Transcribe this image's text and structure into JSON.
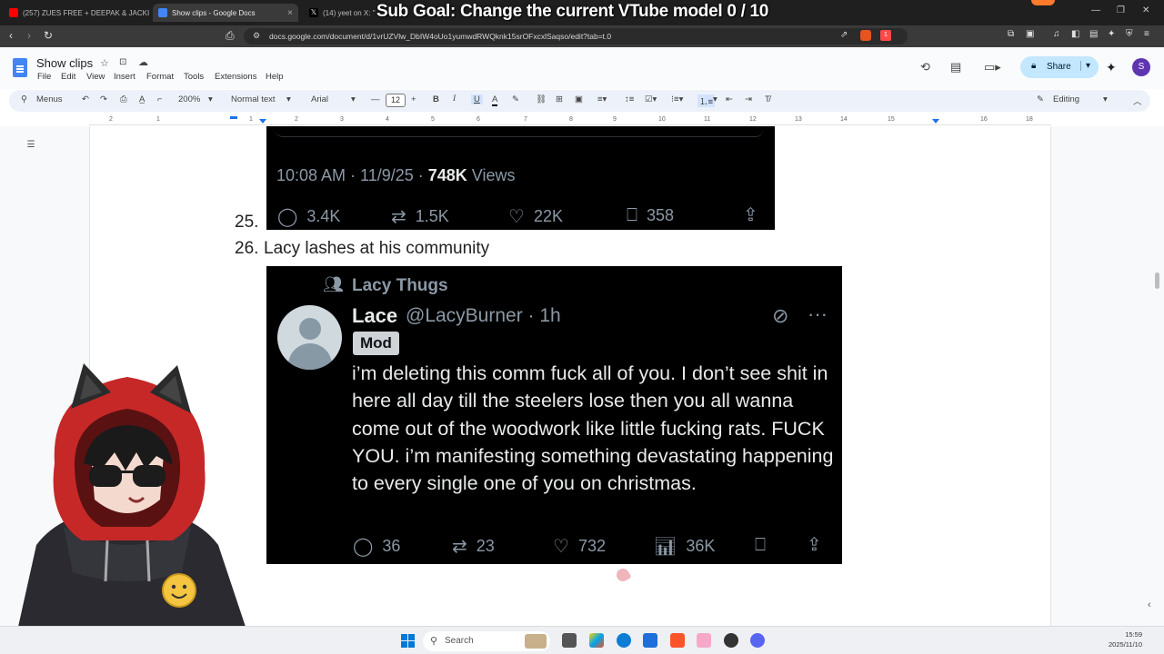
{
  "browser": {
    "tabs": [
      {
        "label": "(257) ZUES FREE + DEEPAK & JACKIE",
        "favicon_color": "#ff0000"
      },
      {
        "label": "Show clips - Google Docs",
        "favicon_color": "#4285f4",
        "close": "×"
      },
      {
        "label": "(14) yeet on X: \"",
        "favicon_color": "#000000"
      }
    ],
    "overlay_text": "Sub Goal: Change the current VTube model  0 / 10",
    "url": "docs.google.com/document/d/1vrUZVlw_DbIW4oUo1yumwdRWQknk15srOFxcxlSaqso/edit?tab=t.0",
    "extension_badge": "1"
  },
  "docs": {
    "title": "Show clips",
    "menus": [
      "File",
      "Edit",
      "View",
      "Insert",
      "Format",
      "Tools",
      "Extensions",
      "Help"
    ],
    "share_label": "Share",
    "avatar_letter": "S",
    "toolbar": {
      "menus_label": "Menus",
      "zoom": "200%",
      "style": "Normal text",
      "font": "Arial",
      "font_size": "12",
      "mode": "Editing"
    },
    "ruler_numbers": [
      "2",
      "1",
      "1",
      "2",
      "3",
      "4",
      "5",
      "6",
      "7",
      "8",
      "9",
      "10",
      "11",
      "12",
      "13",
      "14",
      "15",
      "16",
      "18"
    ]
  },
  "document": {
    "item25_number": "25.",
    "item26_number": "26.",
    "item26_text": "Lacy lashes at his community",
    "tweet1": {
      "timestamp": "10:08 AM · 11/9/25 · ",
      "views_count": "748K",
      "views_label": " Views",
      "replies": "3.4K",
      "reposts": "1.5K",
      "likes": "22K",
      "bookmarks": "358"
    },
    "tweet2": {
      "community": "Lacy Thugs",
      "name": "Lace",
      "handle": "@LacyBurner · 1h",
      "badge": "Mod",
      "body": "i’m deleting this comm fuck all of you. I don’t see shit in here all day till the steelers lose then you all wanna come out of the woodwork like little fucking rats. FUCK YOU. i’m manifesting something devastating happening to every single one of you on christmas.",
      "replies": "36",
      "reposts": "23",
      "likes": "732",
      "views": "36K"
    }
  },
  "taskbar": {
    "search_label": "Search",
    "time": "15:59",
    "date": "2025/11/10"
  },
  "colors": {
    "docs_blue": "#4285f4",
    "share_bg": "#c2e7ff",
    "tweet_bg": "#000000",
    "tweet_muted": "#8b98a5"
  }
}
